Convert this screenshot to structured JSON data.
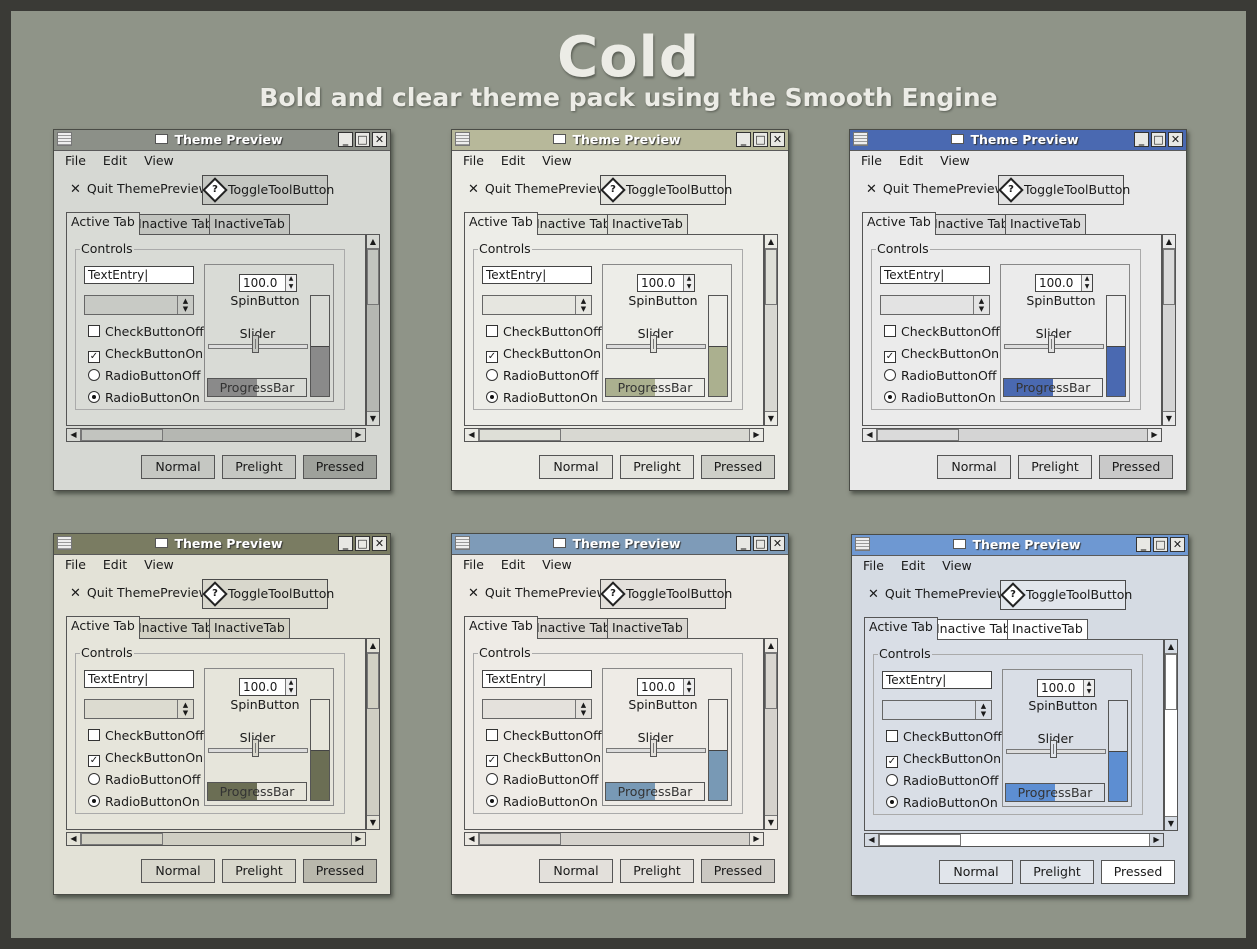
{
  "page": {
    "title": "Cold",
    "subtitle": "Bold and clear theme pack using the Smooth Engine"
  },
  "window": {
    "title": "Theme Preview",
    "menus": [
      "File",
      "Edit",
      "View"
    ],
    "quit_label": "Quit ThemePreview!",
    "toggle_label": "ToggleToolButton",
    "tabs": [
      "Active Tab",
      "Inactive Tab",
      "InactiveTab"
    ],
    "frame_label": "Controls",
    "entry_value": "TextEntry",
    "spin_value": "100.0",
    "spin_label": "SpinButton",
    "slider_label": "Slider",
    "progress_label": "ProgressBar",
    "slider_value": 0.5,
    "progress_value": 0.5,
    "vertical_progress_value": 0.5,
    "checks": [
      "CheckButtonOff",
      "CheckButtonOn"
    ],
    "radios": [
      "RadioButtonOff",
      "RadioButtonOn"
    ],
    "buttons": [
      "Normal",
      "Prelight",
      "Pressed"
    ]
  },
  "themes": [
    {
      "titlebar": "#8c9088",
      "accent": "#8a8a8a",
      "bg": "#d6d8d3",
      "panel": "#d9dbd6",
      "tab": "#c2c4bf",
      "button": "#c5c7c2",
      "pressed": "#9ea19b",
      "trough": "#b5b7b2",
      "combo": "#c8cac5"
    },
    {
      "titlebar": "#b7b89a",
      "accent": "#abb08f",
      "bg": "#ebebe5",
      "panel": "#edede8",
      "tab": "#dedfd7",
      "button": "#e4e4de",
      "pressed": "#cecfc8",
      "trough": "#d8d8d2",
      "combo": "#e6e6e0"
    },
    {
      "titlebar": "#4a69b1",
      "accent": "#4a69b1",
      "bg": "#e9e9e9",
      "panel": "#ebebeb",
      "tab": "#dadada",
      "button": "#e2e2e2",
      "pressed": "#c9c9c9",
      "trough": "#d4d4d4",
      "combo": "#e3e3e3"
    },
    {
      "titlebar": "#7a7c62",
      "accent": "#6b6e54",
      "bg": "#e3e2d7",
      "panel": "#e6e5db",
      "tab": "#d2d1c4",
      "button": "#d8d7cc",
      "pressed": "#b9b8ac",
      "trough": "#cfcec3",
      "combo": "#dcdbd0"
    },
    {
      "titlebar": "#7e9bb8",
      "accent": "#7899b5",
      "bg": "#ece9e3",
      "panel": "#eeebe6",
      "tab": "#d9d6d0",
      "button": "#e3e0db",
      "pressed": "#cbc8c2",
      "trough": "#d5d2cc",
      "combo": "#e4e1dc"
    },
    {
      "titlebar": "#6e98d2",
      "accent": "#5d8ed2",
      "bg": "#d5dbe3",
      "panel": "#d9dee6",
      "tab": "#ffffff",
      "button": "#e1e5eb",
      "pressed": "#ffffff",
      "trough": "#ffffff",
      "combo": "#d9dee6"
    }
  ]
}
